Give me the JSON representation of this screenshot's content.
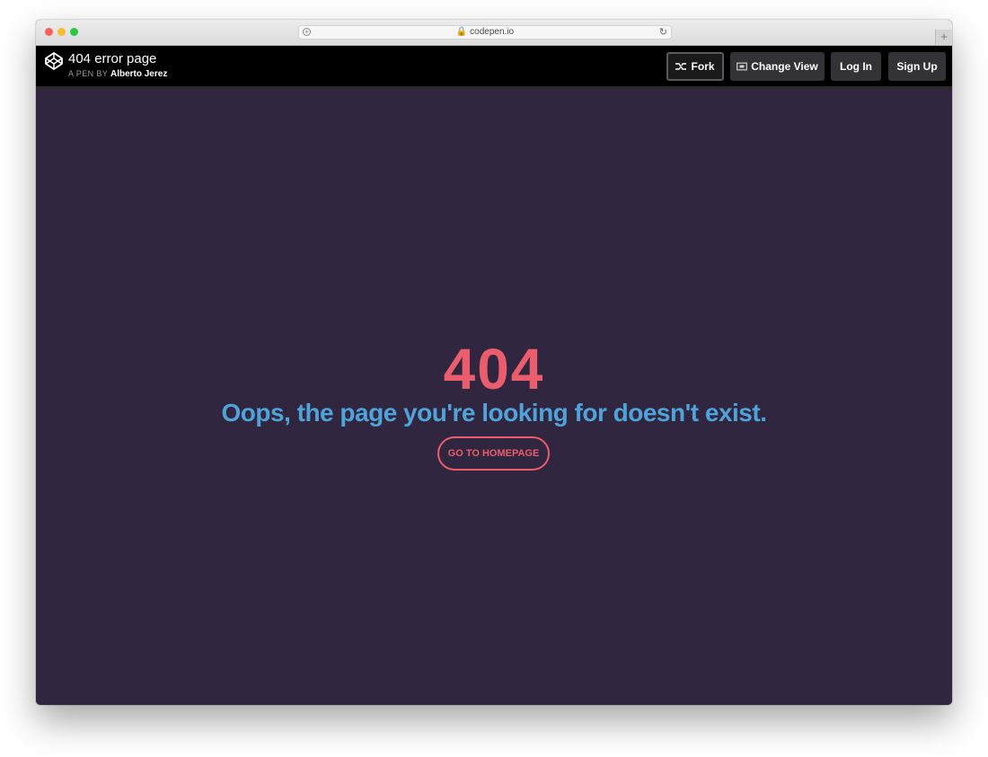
{
  "browser": {
    "url": "codepen.io"
  },
  "pen": {
    "title": "404 error page",
    "by_label": "A PEN BY",
    "author": "Alberto Jerez",
    "buttons": {
      "fork": "Fork",
      "change_view": "Change View",
      "login": "Log In",
      "signup": "Sign Up"
    }
  },
  "page": {
    "code": "404",
    "message": "Oops, the page you're looking for doesn't exist.",
    "home_button": "GO TO HOMEPAGE"
  },
  "colors": {
    "background": "#31263f",
    "accent_red": "#e95d6c",
    "accent_blue": "#4fa3d9"
  }
}
